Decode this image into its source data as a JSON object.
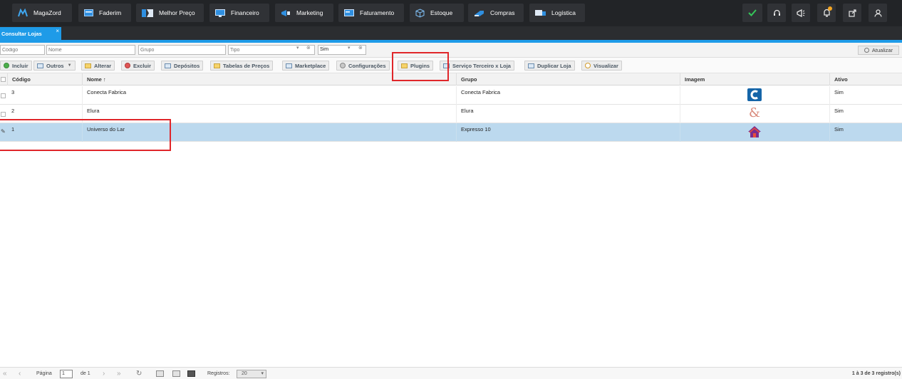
{
  "nav": {
    "menu": [
      {
        "label": "MagaZord",
        "icon": "magazord-logo-icon"
      },
      {
        "label": "Faderim",
        "icon": "window-icon"
      },
      {
        "label": "Melhor Preço",
        "icon": "price-tag-icon"
      },
      {
        "label": "Financeiro",
        "icon": "monitor-money-icon"
      },
      {
        "label": "Marketing",
        "icon": "megaphone-icon"
      },
      {
        "label": "Faturamento",
        "icon": "invoice-icon"
      },
      {
        "label": "Estoque",
        "icon": "box-icon"
      },
      {
        "label": "Compras",
        "icon": "cart-icon"
      },
      {
        "label": "Logística",
        "icon": "truck-icon"
      }
    ],
    "actions": [
      {
        "icon": "check-icon"
      },
      {
        "icon": "headset-icon"
      },
      {
        "icon": "megaphone-icon"
      },
      {
        "icon": "bell-icon"
      },
      {
        "icon": "external-link-icon"
      },
      {
        "icon": "user-icon"
      }
    ]
  },
  "tab": {
    "label": "Consultar Lojas",
    "close": "×"
  },
  "filters": {
    "codigo_placeholder": "Código",
    "nome_placeholder": "Nome",
    "grupo_placeholder": "Grupo",
    "tipo_placeholder": "Tipo",
    "ativo_value": "Sim",
    "refresh_label": "Atualizar"
  },
  "toolbar": {
    "incluir": "Incluir",
    "outros": "Outros",
    "alterar": "Alterar",
    "excluir": "Excluir",
    "depositos": "Depósitos",
    "tabelas_precos": "Tabelas de Preços",
    "marketplace": "Marketplace",
    "configuracoes": "Configurações",
    "plugins": "Plugins",
    "servico_terceiro": "Serviço Terceiro x Loja",
    "duplicar_loja": "Duplicar Loja",
    "visualizar": "Visualizar"
  },
  "grid": {
    "columns": [
      "Código",
      "Nome ↑",
      "Grupo",
      "Imagem",
      "Ativo"
    ],
    "rows": [
      {
        "codigo": "3",
        "nome": "Conecta Fabrica",
        "grupo": "Conecta Fabrica",
        "imagem_icon": "conecta-c-logo-icon",
        "ativo": "Sim",
        "selected": false
      },
      {
        "codigo": "2",
        "nome": "Elura",
        "grupo": "Elura",
        "imagem_icon": "ampersand-logo-icon",
        "ativo": "Sim",
        "selected": false
      },
      {
        "codigo": "1",
        "nome": "Universo do Lar",
        "grupo": "Expresso 10",
        "imagem_icon": "house-logo-icon",
        "ativo": "Sim",
        "selected": true
      }
    ]
  },
  "footer": {
    "pagina_label": "Página",
    "page_value": "1",
    "de_label": "de 1",
    "registros_label": "Registros:",
    "registros_value": "20",
    "summary": "1 à 3 de 3 registro(s)"
  },
  "colors": {
    "topbar": "#222427",
    "accent": "#1e9be8",
    "selected_row": "#bcd9ee",
    "highlight": "#e0262a"
  }
}
